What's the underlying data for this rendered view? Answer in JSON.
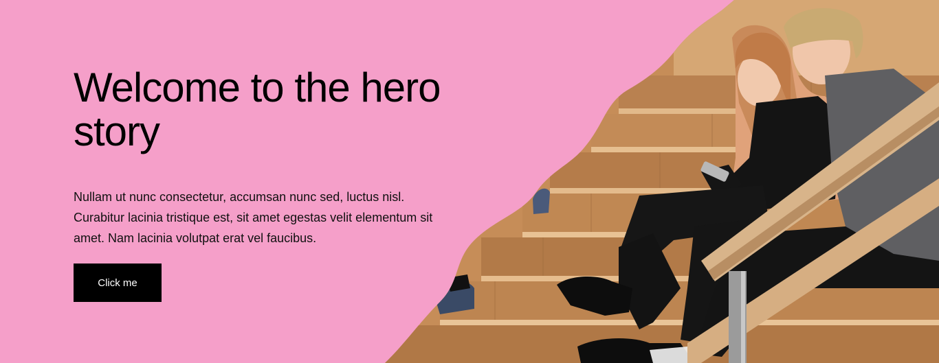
{
  "hero": {
    "title_line1": "Welcome to the hero",
    "title_line2": "story",
    "body_line1": "Nullam ut nunc consectetur, accumsan nunc sed, luctus nisl.",
    "body_line2": "Curabitur lacinia tristique est, sit amet egestas velit elementum sit",
    "body_line3": "amet. Nam lacinia volutpat erat vel faucibus.",
    "button_label": "Click me"
  },
  "colors": {
    "background": "#f59fc9",
    "button": "#000000",
    "button_text": "#ffffff",
    "wood": "#c9925e"
  }
}
